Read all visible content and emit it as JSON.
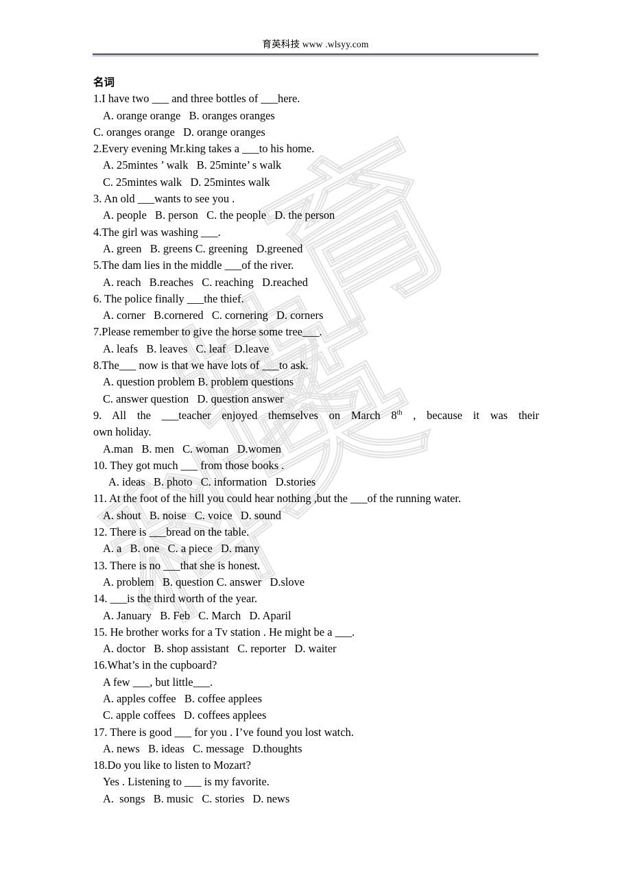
{
  "header": {
    "text": "育英科技 www .wlsyy.com"
  },
  "section": {
    "title": "名词"
  },
  "questions": [
    {
      "id": "q1",
      "stem": "1.I have two ___ and three bottles of ___here.",
      "option_lines": [
        "A. orange orange   B. oranges oranges",
        "C. oranges orange   D. orange oranges"
      ]
    },
    {
      "id": "q2",
      "stem": "2.Every evening Mr.king takes a ___to his home.",
      "option_lines": [
        "A. 25mintes ’ walk   B. 25minte’ s walk",
        "C. 25mintes walk   D. 25mintes walk"
      ]
    },
    {
      "id": "q3",
      "stem": "3. An old ___wants to see you .",
      "option_lines": [
        "A. people   B. person   C. the people   D. the person"
      ]
    },
    {
      "id": "q4",
      "stem": "4.The girl was washing ___.",
      "option_lines": [
        "A. green   B. greens C. greening   D.greened"
      ]
    },
    {
      "id": "q5",
      "stem": "5.The dam lies in the middle ___of the river.",
      "option_lines": [
        "A. reach   B.reaches   C. reaching   D.reached"
      ]
    },
    {
      "id": "q6",
      "stem": "6. The police finally ___the thief.",
      "option_lines": [
        "A. corner   B.cornered   C. cornering   D. corners"
      ]
    },
    {
      "id": "q7",
      "stem": "7.Please remember to give the horse some tree___.",
      "option_lines": [
        "A. leafs   B. leaves   C. leaf   D.leave"
      ]
    },
    {
      "id": "q8",
      "stem": "8.The___ now is that we have lots of ___to ask.",
      "option_lines": [
        "A. question problem B. problem questions",
        "C. answer question   D. question answer"
      ]
    },
    {
      "id": "q9",
      "stem_line1_a": "9.  All  the  ___teacher  enjoyed  themselves  on  March  8",
      "stem_line1_sup": "th",
      "stem_line1_b": " ,  because  it  was  their",
      "stem_line2": "own holiday.",
      "option_lines": [
        "A.man   B. men   C. woman   D.women"
      ]
    },
    {
      "id": "q10",
      "stem": "10. They got much ___ from those books .",
      "option_lines": [
        "A. ideas   B. photo   C. information   D.stories"
      ]
    },
    {
      "id": "q11",
      "stem": "11. At the foot of the hill you could hear nothing ,but the ___of the running water.",
      "option_lines": [
        "A. shout   B. noise   C. voice   D. sound"
      ]
    },
    {
      "id": "q12",
      "stem": "12. There is ___bread on the table.",
      "option_lines": [
        "A. a   B. one   C. a piece   D. many"
      ]
    },
    {
      "id": "q13",
      "stem": "13. There is no ___that she is honest.",
      "option_lines": [
        "A. problem   B. question C. answer   D.slove"
      ]
    },
    {
      "id": "q14",
      "stem": "14. ___is the third worth of the year.",
      "option_lines": [
        "A. January   B. Feb   C. March   D. Aparil"
      ]
    },
    {
      "id": "q15",
      "stem": "15. He brother works for a Tv station . He might be a ___.",
      "option_lines": [
        "A. doctor   B. shop assistant   C. reporter   D. waiter"
      ]
    },
    {
      "id": "q16",
      "stem": "16.What’s in the cupboard?",
      "sub_stem": "A few ___, but little___.",
      "option_lines": [
        "A. apples coffee   B. coffee applees",
        "C. apple coffees   D. coffees applees"
      ]
    },
    {
      "id": "q17",
      "stem": "17. There is good ___ for you . I’ve found you lost watch.",
      "option_lines": [
        "A. news   B. ideas   C. message   D.thoughts"
      ]
    },
    {
      "id": "q18",
      "stem": "18.Do you like to listen to Mozart?",
      "sub_stem": "Yes . Listening to ___ is my favorite.",
      "option_lines": [
        "A.  songs   B. music   C. stories   D. news"
      ]
    }
  ],
  "watermark": {
    "characters": "育英科技",
    "color": "#e3e3e3"
  }
}
